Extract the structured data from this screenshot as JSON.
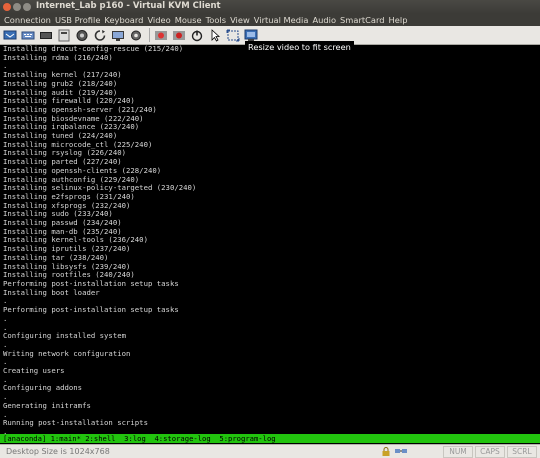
{
  "window": {
    "title": "Internet_Lab p160 - Virtual KVM Client"
  },
  "menu": [
    "Connection",
    "USB Profile",
    "Keyboard",
    "Video",
    "Mouse",
    "Tools",
    "View",
    "Virtual Media",
    "Audio",
    "SmartCard",
    "Help"
  ],
  "toolbar": {
    "tooltip": "Resize video to fit screen",
    "buttons": [
      "connect-icon",
      "keyboard-icon",
      "macro-icon",
      "usb-icon",
      "video-icon",
      "refresh-icon",
      "monitor-icon",
      "settings-icon",
      "record-icon",
      "record-alt-icon",
      "power-icon",
      "mouse-pointer-icon",
      "resize-fit-icon",
      "fit-screen-icon"
    ]
  },
  "terminal": {
    "lines": [
      "Installing dracut-config-rescue (215/240)",
      "Installing rdma (216/240)",
      ".",
      "Installing kernel (217/240)",
      "Installing grub2 (218/240)",
      "Installing audit (219/240)",
      "Installing firewalld (220/240)",
      "Installing openssh-server (221/240)",
      "Installing biosdevname (222/240)",
      "Installing irqbalance (223/240)",
      "Installing tuned (224/240)",
      "Installing microcode_ctl (225/240)",
      "Installing rsyslog (226/240)",
      "Installing parted (227/240)",
      "Installing openssh-clients (228/240)",
      "Installing authconfig (229/240)",
      "Installing selinux-policy-targeted (230/240)",
      "Installing e2fsprogs (231/240)",
      "Installing xfsprogs (232/240)",
      "Installing sudo (233/240)",
      "Installing passwd (234/240)",
      "Installing man-db (235/240)",
      "Installing kernel-tools (236/240)",
      "Installing iprutils (237/240)",
      "Installing tar (238/240)",
      "Installing libsysfs (239/240)",
      "Installing rootfiles (240/240)",
      "Performing post-installation setup tasks",
      "Installing boot loader",
      ".",
      "Performing post-installation setup tasks",
      ".",
      ".",
      "Configuring installed system",
      ".",
      "Writing network configuration",
      ".",
      "Creating users",
      ".",
      "Configuring addons",
      ".",
      "Generating initramfs",
      ".",
      "Running post-installation scripts",
      ".",
      ".",
      "Pane is dead"
    ],
    "tmux_status": "[anaconda] 1:main* 2:shell  3:log  4:storage-log  5:program-log"
  },
  "statusbar": {
    "text": "Desktop Size is 1024x768",
    "keys": [
      "NUM",
      "CAPS",
      "SCRL"
    ],
    "icons": [
      "lock-icon",
      "network-icon"
    ]
  },
  "colors": {
    "tmux_green": "#22c40e",
    "terminal_bg": "#000000",
    "close_button": "#e7633b"
  }
}
